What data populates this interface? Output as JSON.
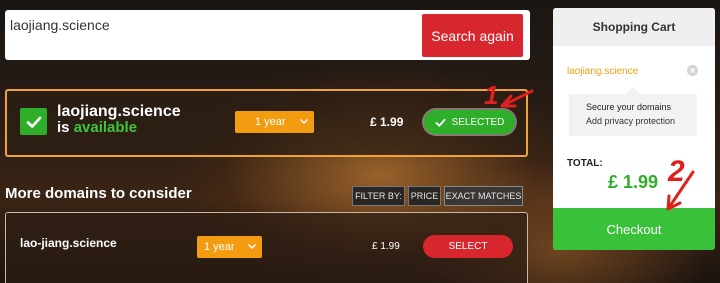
{
  "search": {
    "value": "laojiang.science",
    "button_label": "Search again"
  },
  "main_result": {
    "domain": "laojiang.science",
    "status_prefix": "is",
    "status_word": "available",
    "period": "1 year",
    "price": "£ 1.99",
    "button_label": "SELECTED"
  },
  "more": {
    "title": "More domains to consider",
    "filter_label": "FILTER BY:",
    "filter_price": "PRICE",
    "filter_exact": "EXACT MATCHES"
  },
  "results": [
    {
      "domain": "lao-jiang.science",
      "period": "1 year",
      "price": "£ 1.99",
      "button_label": "SELECT"
    }
  ],
  "cart": {
    "title": "Shopping Cart",
    "item_domain": "laojiang.science",
    "upsell_title": "Secure your domains",
    "upsell_sub": "Add privacy protection",
    "total_label": "TOTAL:",
    "total_value": "£ 1.99",
    "checkout_label": "Checkout"
  },
  "annotations": {
    "mark_1": "1",
    "mark_2": "2"
  },
  "colors": {
    "accent_red": "#d8262e",
    "accent_green": "#2fae2a",
    "accent_orange": "#f39c12"
  }
}
